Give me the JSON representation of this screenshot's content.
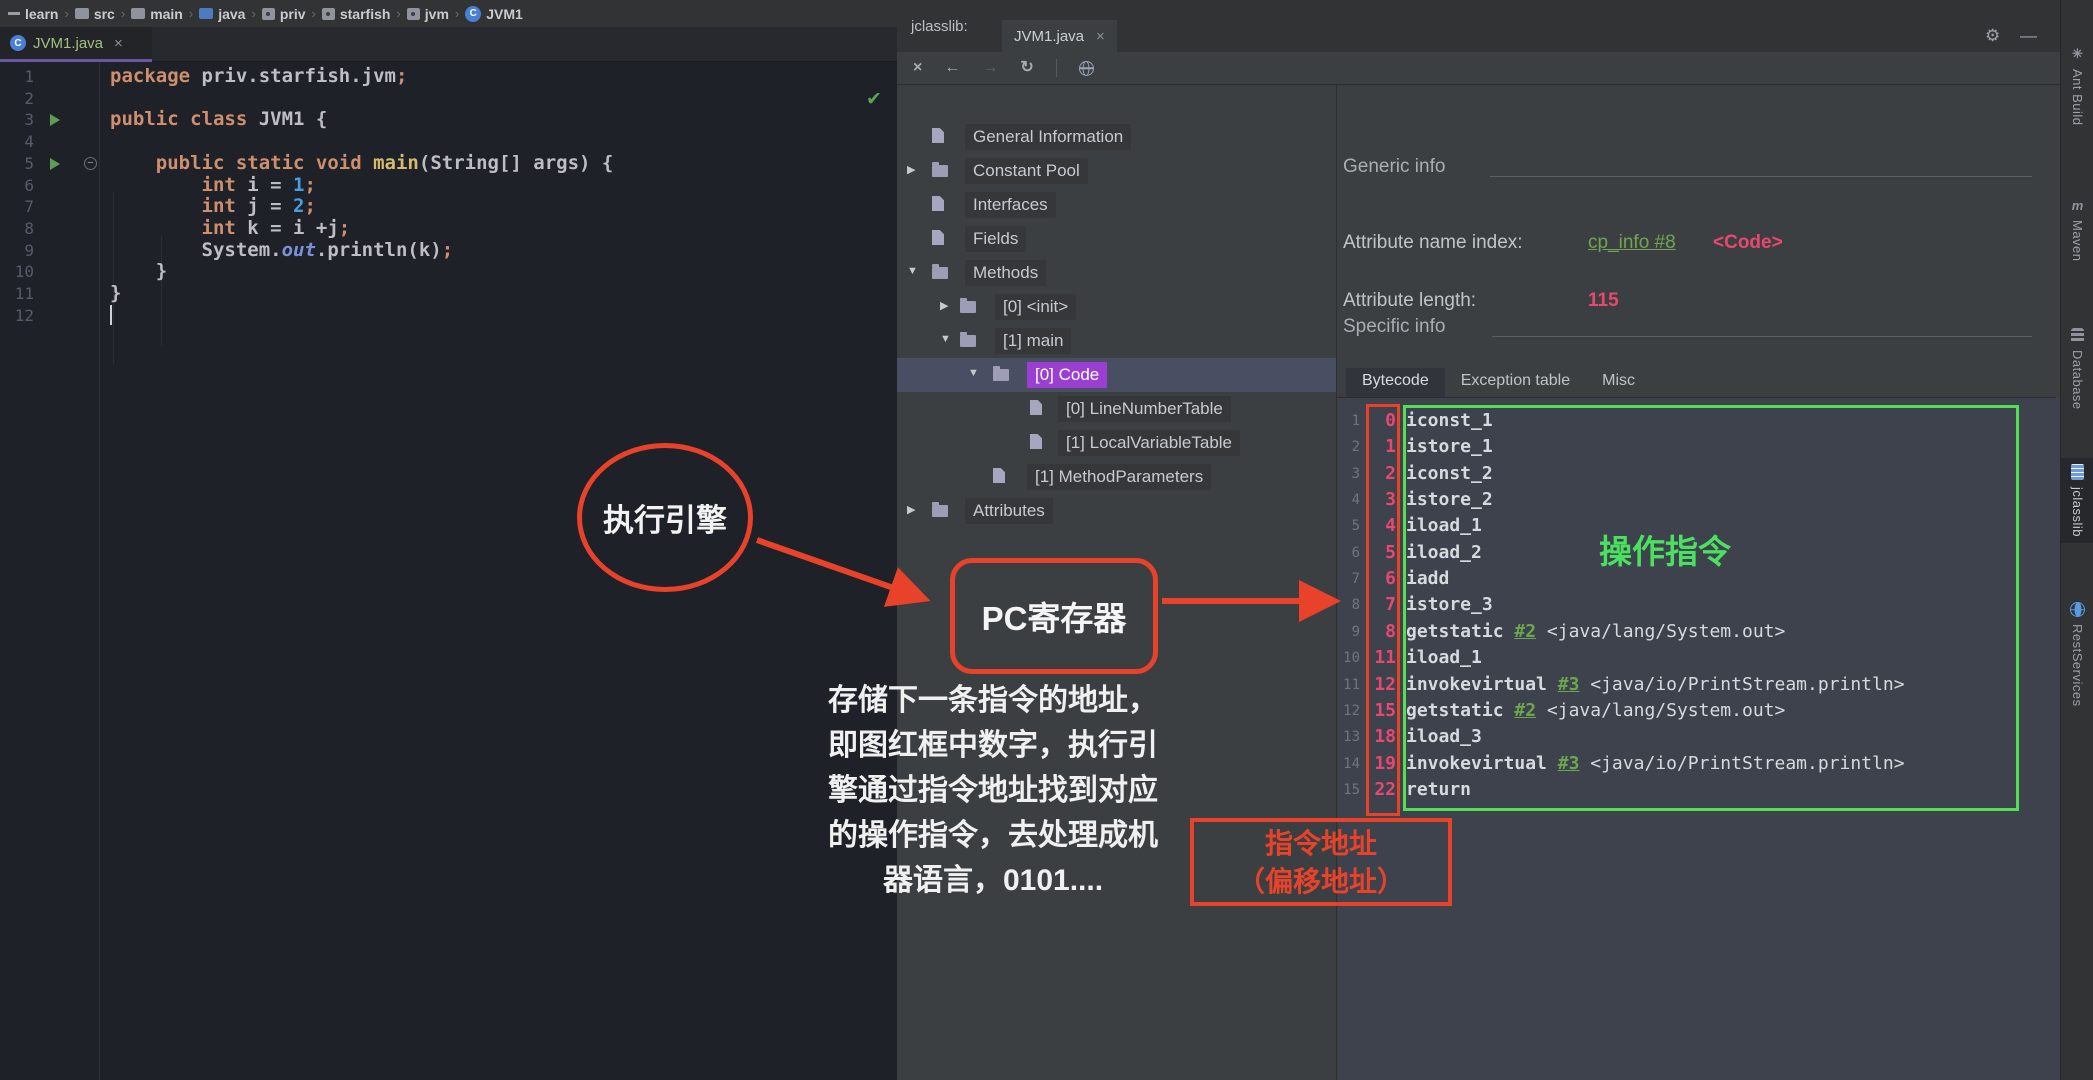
{
  "icons": {
    "checkmark": "✔",
    "gear": "⚙",
    "minimize": "—",
    "close": "×",
    "back": "←",
    "forward": "→",
    "refresh": "↻",
    "chevron": "›",
    "tab_close": "×",
    "arrow_right": "▶",
    "arrow_down": "▼",
    "fold_minus": "−"
  },
  "breadcrumb": {
    "items": [
      {
        "label": "learn",
        "icon": "project"
      },
      {
        "label": "src",
        "icon": "folder"
      },
      {
        "label": "main",
        "icon": "folder"
      },
      {
        "label": "java",
        "icon": "folder-java"
      },
      {
        "label": "priv",
        "icon": "package"
      },
      {
        "label": "starfish",
        "icon": "package"
      },
      {
        "label": "jvm",
        "icon": "package"
      },
      {
        "label": "JVM1",
        "icon": "class"
      }
    ]
  },
  "editor": {
    "tab_title": "JVM1.java",
    "lines": [
      {
        "n": 1,
        "segs": [
          [
            "kw",
            "package "
          ],
          [
            "pl",
            "priv.starfish.jvm"
          ],
          [
            "kw",
            ";"
          ]
        ]
      },
      {
        "n": 2,
        "segs": []
      },
      {
        "n": 3,
        "run": true,
        "segs": [
          [
            "kw",
            "public class "
          ],
          [
            "pl",
            "JVM1 {"
          ]
        ]
      },
      {
        "n": 4,
        "segs": []
      },
      {
        "n": 5,
        "run": true,
        "fold": true,
        "segs": [
          [
            "pl",
            "    "
          ],
          [
            "kw",
            "public static void "
          ],
          [
            "fn",
            "main"
          ],
          [
            "pl",
            "(String[] args) {"
          ]
        ]
      },
      {
        "n": 6,
        "segs": [
          [
            "pl",
            "        "
          ],
          [
            "kw",
            "int "
          ],
          [
            "pl",
            "i = "
          ],
          [
            "num",
            "1"
          ],
          [
            "kw",
            ";"
          ]
        ]
      },
      {
        "n": 7,
        "segs": [
          [
            "pl",
            "        "
          ],
          [
            "kw",
            "int "
          ],
          [
            "pl",
            "j = "
          ],
          [
            "num",
            "2"
          ],
          [
            "kw",
            ";"
          ]
        ]
      },
      {
        "n": 8,
        "segs": [
          [
            "pl",
            "        "
          ],
          [
            "kw",
            "int "
          ],
          [
            "pl",
            "k = i +j"
          ],
          [
            "kw",
            ";"
          ]
        ]
      },
      {
        "n": 9,
        "segs": [
          [
            "pl",
            "        System."
          ],
          [
            "fld",
            "out"
          ],
          [
            "pl",
            ".println(k)"
          ],
          [
            "kw",
            ";"
          ]
        ]
      },
      {
        "n": 10,
        "segs": [
          [
            "pl",
            "    }"
          ]
        ]
      },
      {
        "n": 11,
        "segs": [
          [
            "pl",
            "}"
          ]
        ]
      },
      {
        "n": 12,
        "caret": true,
        "segs": []
      }
    ]
  },
  "jclasslib": {
    "panel_label": "jclasslib:",
    "tab_title": "JVM1.java",
    "tree": [
      {
        "label": "General Information",
        "icon": "doc",
        "depth": 0
      },
      {
        "label": "Constant Pool",
        "icon": "folder",
        "depth": 0,
        "arrow": "right"
      },
      {
        "label": "Interfaces",
        "icon": "doc",
        "depth": 0
      },
      {
        "label": "Fields",
        "icon": "doc",
        "depth": 0
      },
      {
        "label": "Methods",
        "icon": "folder",
        "depth": 0,
        "arrow": "down"
      },
      {
        "label": "[0] <init>",
        "icon": "folder",
        "depth": 1,
        "arrow": "right"
      },
      {
        "label": "[1] main",
        "icon": "folder",
        "depth": 1,
        "arrow": "down"
      },
      {
        "label": "[0] Code",
        "icon": "folder",
        "depth": 2,
        "arrow": "down",
        "selected": true
      },
      {
        "label": "[0] LineNumberTable",
        "icon": "doc",
        "depth": 3
      },
      {
        "label": "[1] LocalVariableTable",
        "icon": "doc",
        "depth": 3
      },
      {
        "label": "[1] MethodParameters",
        "icon": "doc",
        "depth": 2
      },
      {
        "label": "Attributes",
        "icon": "folder",
        "depth": 0,
        "arrow": "right"
      }
    ],
    "generic_info_title": "Generic info",
    "attr_name_label": "Attribute name index:",
    "attr_name_link": "cp_info #8",
    "attr_name_badge": "<Code>",
    "attr_len_label": "Attribute length:",
    "attr_len_value": "115",
    "specific_info_title": "Specific info",
    "tabs": [
      {
        "label": "Bytecode",
        "active": true
      },
      {
        "label": "Exception table",
        "active": false
      },
      {
        "label": "Misc",
        "active": false
      }
    ],
    "bytecode": [
      {
        "line": "1",
        "offset": "0",
        "instr": "iconst_1",
        "link": "",
        "rest": ""
      },
      {
        "line": "2",
        "offset": "1",
        "instr": "istore_1",
        "link": "",
        "rest": ""
      },
      {
        "line": "3",
        "offset": "2",
        "instr": "iconst_2",
        "link": "",
        "rest": ""
      },
      {
        "line": "4",
        "offset": "3",
        "instr": "istore_2",
        "link": "",
        "rest": ""
      },
      {
        "line": "5",
        "offset": "4",
        "instr": "iload_1",
        "link": "",
        "rest": ""
      },
      {
        "line": "6",
        "offset": "5",
        "instr": "iload_2",
        "link": "",
        "rest": ""
      },
      {
        "line": "7",
        "offset": "6",
        "instr": "iadd",
        "link": "",
        "rest": ""
      },
      {
        "line": "8",
        "offset": "7",
        "instr": "istore_3",
        "link": "",
        "rest": ""
      },
      {
        "line": "9",
        "offset": "8",
        "instr": "getstatic",
        "link": "#2",
        "rest": " <java/lang/System.out>"
      },
      {
        "line": "10",
        "offset": "11",
        "instr": "iload_1",
        "link": "",
        "rest": ""
      },
      {
        "line": "11",
        "offset": "12",
        "instr": "invokevirtual",
        "link": "#3",
        "rest": " <java/io/PrintStream.println>"
      },
      {
        "line": "12",
        "offset": "15",
        "instr": "getstatic",
        "link": "#2",
        "rest": " <java/lang/System.out>"
      },
      {
        "line": "13",
        "offset": "18",
        "instr": "iload_3",
        "link": "",
        "rest": ""
      },
      {
        "line": "14",
        "offset": "19",
        "instr": "invokevirtual",
        "link": "#3",
        "rest": " <java/io/PrintStream.println>"
      },
      {
        "line": "15",
        "offset": "22",
        "instr": "return",
        "link": "",
        "rest": ""
      }
    ]
  },
  "annotations": {
    "engine_label": "执行引擎",
    "pc_label": "PC寄存器",
    "paragraph": [
      "存储下一条指令的地址，",
      "即图红框中数字，执行引",
      "擎通过指令地址找到对应",
      "的操作指令，去处理成机",
      "器语言，0101...."
    ],
    "opcode_label": "操作指令",
    "addr_label_line1": "指令地址",
    "addr_label_line2": "（偏移地址）",
    "colors": {
      "red": "#e8432a",
      "green": "#4be05f",
      "pink": "#e8486f",
      "link_green": "#72a353",
      "selection_purple": "#9a3fd2"
    }
  },
  "toolstripe": {
    "items": [
      {
        "label": "Ant Build",
        "icon": "ant",
        "active": false
      },
      {
        "label": "Maven",
        "icon": "maven",
        "active": false
      },
      {
        "label": "Database",
        "icon": "database",
        "active": false
      },
      {
        "label": "jclasslib",
        "icon": "jclasslib",
        "active": true
      },
      {
        "label": "RestServices",
        "icon": "rest",
        "active": false
      }
    ]
  }
}
